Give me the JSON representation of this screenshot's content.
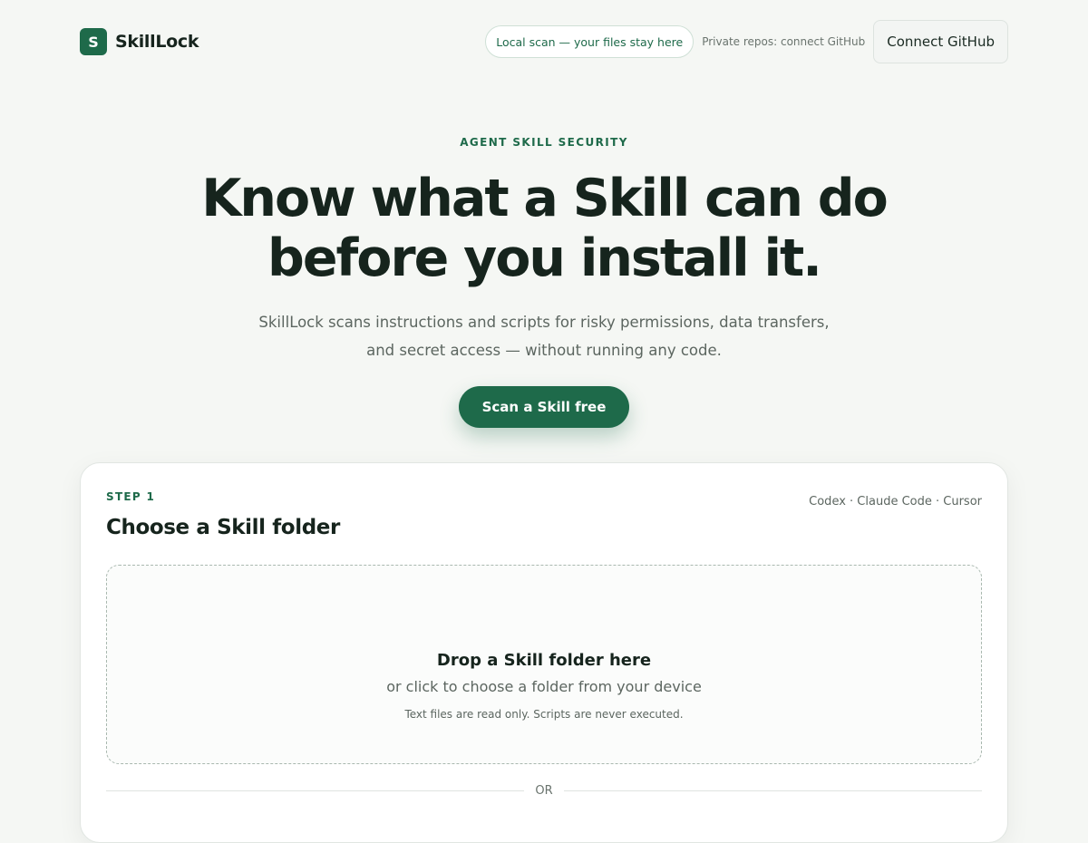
{
  "header": {
    "logo_letter": "S",
    "brand_name": "SkillLock",
    "local_scan_pill": "Local scan — your files stay here",
    "private_repos_note": "Private repos: connect GitHub",
    "connect_button": "Connect GitHub"
  },
  "hero": {
    "eyebrow": "AGENT SKILL SECURITY",
    "headline_line1": "Know what a Skill can do",
    "headline_line2": "before you install it.",
    "subhead": "SkillLock scans instructions and scripts for risky permissions, data transfers, and secret access — without running any code.",
    "cta_label": "Scan a Skill free"
  },
  "card": {
    "step_label": "STEP 1",
    "title": "Choose a Skill folder",
    "platforms": "Codex · Claude Code · Cursor",
    "dropzone": {
      "title": "Drop a Skill folder here",
      "subtitle": "or click to choose a folder from your device",
      "note": "Text files are read only. Scripts are never executed."
    },
    "divider_label": "OR"
  },
  "colors": {
    "accent": "#1e6a4a",
    "background": "#f5f7f4",
    "text_primary": "#16241d",
    "text_secondary": "#5c6660"
  }
}
